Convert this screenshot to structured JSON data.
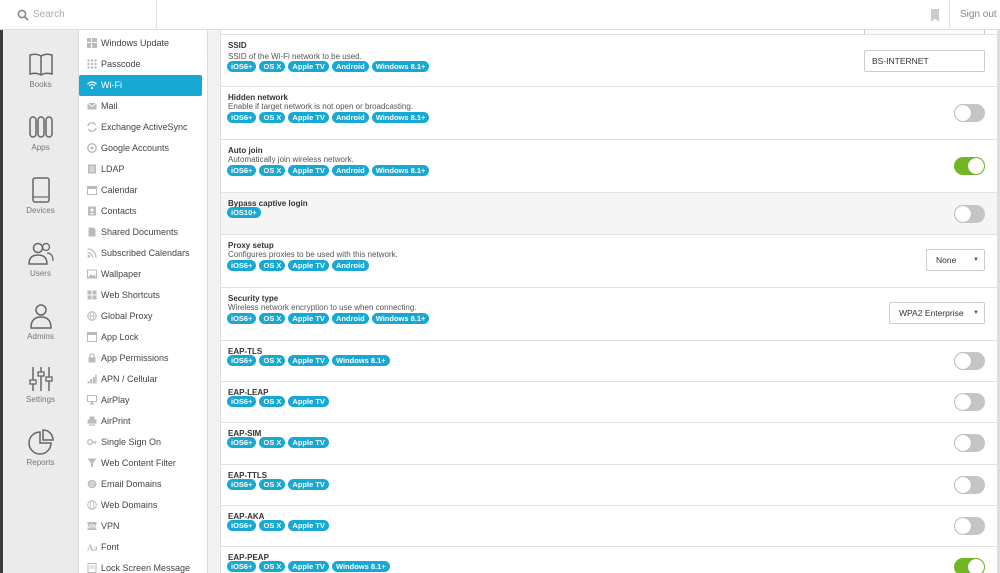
{
  "search": {
    "placeholder": "Search"
  },
  "header": {
    "sign_out": "Sign out"
  },
  "nav": [
    {
      "label": "Books",
      "icon": "book-icon"
    },
    {
      "label": "Apps",
      "icon": "apps-icon"
    },
    {
      "label": "Devices",
      "icon": "tablet-icon"
    },
    {
      "label": "Users",
      "icon": "users-icon"
    },
    {
      "label": "Admins",
      "icon": "admin-icon"
    },
    {
      "label": "Settings",
      "icon": "sliders-icon"
    },
    {
      "label": "Reports",
      "icon": "pie-chart-icon"
    }
  ],
  "payloads": [
    {
      "label": "Windows Update"
    },
    {
      "label": "Passcode"
    },
    {
      "label": "Wi-Fi",
      "active": true
    },
    {
      "label": "Mail"
    },
    {
      "label": "Exchange ActiveSync"
    },
    {
      "label": "Google Accounts"
    },
    {
      "label": "LDAP"
    },
    {
      "label": "Calendar"
    },
    {
      "label": "Contacts"
    },
    {
      "label": "Shared Documents"
    },
    {
      "label": "Subscribed Calendars"
    },
    {
      "label": "Wallpaper"
    },
    {
      "label": "Web Shortcuts"
    },
    {
      "label": "Global Proxy"
    },
    {
      "label": "App Lock"
    },
    {
      "label": "App Permissions"
    },
    {
      "label": "APN / Cellular"
    },
    {
      "label": "AirPlay"
    },
    {
      "label": "AirPrint"
    },
    {
      "label": "Single Sign On"
    },
    {
      "label": "Web Content Filter"
    },
    {
      "label": "Email Domains"
    },
    {
      "label": "Web Domains"
    },
    {
      "label": "VPN"
    },
    {
      "label": "Font"
    },
    {
      "label": "Lock Screen Message"
    }
  ],
  "settings": [
    {
      "title": "SSID",
      "desc": "SSID of the Wi-Fi network to be used.",
      "badges": [
        "iOS6+",
        "OS X",
        "Apple TV",
        "Android",
        "Windows 8.1+"
      ],
      "control": "text",
      "value": "BS-INTERNET"
    },
    {
      "title": "Hidden network",
      "desc": "Enable if target network is not open or broadcasting.",
      "badges": [
        "iOS6+",
        "OS X",
        "Apple TV",
        "Android",
        "Windows 8.1+"
      ],
      "control": "toggle",
      "on": false
    },
    {
      "title": "Auto join",
      "desc": "Automatically join wireless network.",
      "badges": [
        "iOS6+",
        "OS X",
        "Apple TV",
        "Android",
        "Windows 8.1+"
      ],
      "control": "toggle",
      "on": true
    },
    {
      "title": "Bypass captive login",
      "desc": "",
      "badges": [
        "iOS10+"
      ],
      "control": "toggle",
      "on": false
    },
    {
      "title": "Proxy setup",
      "desc": "Configures proxies to be used with this network.",
      "badges": [
        "iOS6+",
        "OS X",
        "Apple TV",
        "Android"
      ],
      "control": "select",
      "value": "None"
    },
    {
      "title": "Security type",
      "desc": "Wireless network encryption to use when connecting.",
      "badges": [
        "iOS6+",
        "OS X",
        "Apple TV",
        "Android",
        "Windows 8.1+"
      ],
      "control": "select",
      "value": "WPA2 Enterprise"
    },
    {
      "title": "EAP-TLS",
      "desc": "",
      "badges": [
        "iOS6+",
        "OS X",
        "Apple TV",
        "Windows 8.1+"
      ],
      "control": "toggle",
      "on": false
    },
    {
      "title": "EAP-LEAP",
      "desc": "",
      "badges": [
        "iOS6+",
        "OS X",
        "Apple TV"
      ],
      "control": "toggle",
      "on": false
    },
    {
      "title": "EAP-SIM",
      "desc": "",
      "badges": [
        "iOS6+",
        "OS X",
        "Apple TV"
      ],
      "control": "toggle",
      "on": false
    },
    {
      "title": "EAP-TTLS",
      "desc": "",
      "badges": [
        "iOS6+",
        "OS X",
        "Apple TV"
      ],
      "control": "toggle",
      "on": false
    },
    {
      "title": "EAP-AKA",
      "desc": "",
      "badges": [
        "iOS6+",
        "OS X",
        "Apple TV"
      ],
      "control": "toggle",
      "on": false
    },
    {
      "title": "EAP-PEAP",
      "desc": "",
      "badges": [
        "iOS6+",
        "OS X",
        "Apple TV",
        "Windows 8.1+"
      ],
      "control": "toggle",
      "on": true
    }
  ],
  "colors": {
    "accent": "#18a8d4",
    "toggle_on": "#72b626",
    "toggle_off": "#c5c5c5"
  }
}
